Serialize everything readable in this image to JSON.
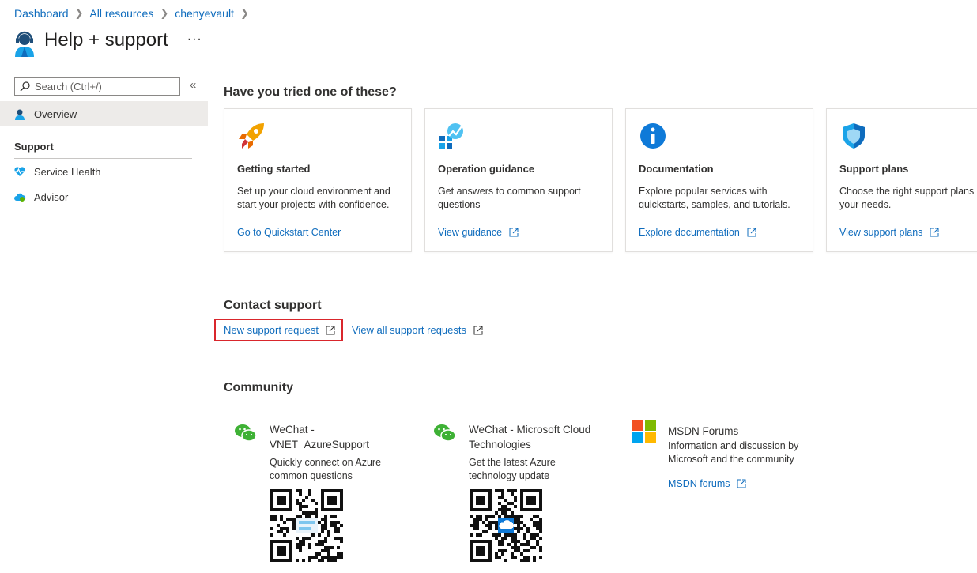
{
  "breadcrumb": [
    "Dashboard",
    "All resources",
    "chenyevault"
  ],
  "page": {
    "title": "Help + support",
    "more": "···"
  },
  "sidebar": {
    "search_placeholder": "Search (Ctrl+/)",
    "collapse": "«",
    "overview": "Overview",
    "section": "Support",
    "items": [
      "Service Health",
      "Advisor"
    ]
  },
  "tried": {
    "heading": "Have you tried one of these?",
    "cards": [
      {
        "icon": "rocket-icon",
        "title": "Getting started",
        "desc": [
          "Set up your cloud environment and",
          "start your projects with confidence."
        ],
        "link": "Go to Quickstart Center",
        "external": false
      },
      {
        "icon": "operation-chart-icon",
        "title": "Operation guidance",
        "desc": [
          "Get answers to common support",
          "questions"
        ],
        "link": "View guidance",
        "external": true
      },
      {
        "icon": "info-icon",
        "title": "Documentation",
        "desc": [
          "Explore popular services with",
          "quickstarts, samples, and tutorials."
        ],
        "link": "Explore documentation",
        "external": true
      },
      {
        "icon": "shield-icon",
        "title": "Support plans",
        "desc": [
          "Choose the right support plans",
          "your needs."
        ],
        "link": "View support plans",
        "external": true
      }
    ]
  },
  "contact": {
    "heading": "Contact support",
    "new_request": "New support request",
    "view_all": "View all support requests"
  },
  "community": {
    "heading": "Community",
    "items": [
      {
        "icon": "wechat-icon",
        "title": [
          "WeChat -",
          "VNET_AzureSupport"
        ],
        "desc": [
          "Quickly connect on Azure",
          "common questions"
        ]
      },
      {
        "icon": "wechat-icon",
        "title": [
          "WeChat - Microsoft Cloud",
          "Technologies"
        ],
        "desc": [
          "Get the latest Azure",
          "technology update"
        ]
      },
      {
        "icon": "microsoft-logo-icon",
        "title": [
          "MSDN Forums"
        ],
        "desc": [
          "Information and discussion by",
          "Microsoft and the community"
        ],
        "link": "MSDN forums"
      }
    ]
  },
  "colors": {
    "link": "#0f6cbd",
    "highlight": "#d9262c",
    "selected_bg": "#edebe9"
  }
}
